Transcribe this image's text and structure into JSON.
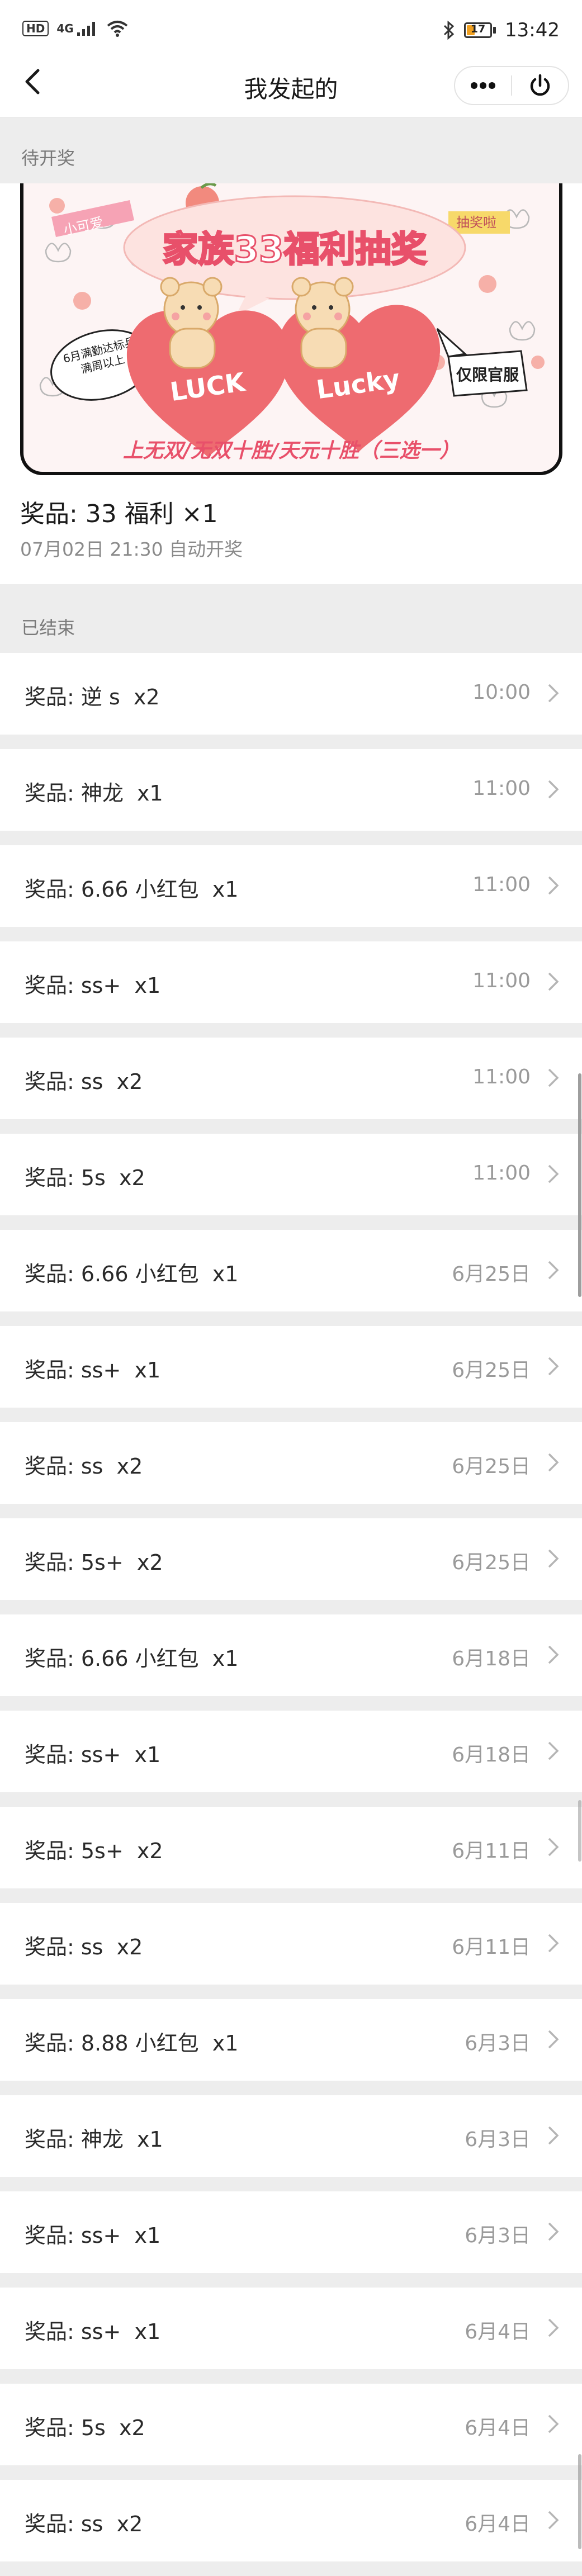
{
  "status_bar": {
    "left_badge": "HD",
    "network": "4G",
    "battery": "17",
    "time": "13:42",
    "icons": [
      "sim-icon",
      "signal-icon",
      "wifi-icon",
      "bluetooth-icon",
      "battery-icon"
    ]
  },
  "nav": {
    "title": "我发起的",
    "back_icon": "back-arrow-icon",
    "more_icon": "more-dots-icon",
    "close_icon": "power-icon"
  },
  "sections": {
    "pending": "待开奖",
    "ended": "已结束"
  },
  "pending": {
    "banner": {
      "headline": "家族33福利抽奖",
      "corner_tag_left": "小可爱",
      "corner_tag_right": "抽奖啦",
      "left_note": "6月满勤达标兵满周以上",
      "heart_left": "LUCK",
      "heart_right": "Lucky",
      "badge": "仅限官服",
      "bottom_text": "上无双/无双十胜/天元十胜（三选一）",
      "colors": {
        "pink": "#e8506a",
        "heart": "#ee6b70",
        "frame": "#111111",
        "bubble": "#fde3e0"
      }
    },
    "prize": "奖品: 33 福利 ×1",
    "draw_time": "07月02日 21:30 自动开奖"
  },
  "ended": [
    {
      "prize": "奖品: 逆 s  x2",
      "date": "10:00"
    },
    {
      "prize": "奖品: 神龙  x1",
      "date": "11:00"
    },
    {
      "prize": "奖品: 6.66 小红包  x1",
      "date": "11:00"
    },
    {
      "prize": "奖品: ss+  x1",
      "date": "11:00"
    },
    {
      "prize": "奖品: ss  x2",
      "date": "11:00"
    },
    {
      "prize": "奖品: 5s  x2",
      "date": "11:00"
    },
    {
      "prize": "奖品: 6.66 小红包  x1",
      "date": "6月25日"
    },
    {
      "prize": "奖品: ss+  x1",
      "date": "6月25日"
    },
    {
      "prize": "奖品: ss  x2",
      "date": "6月25日"
    },
    {
      "prize": "奖品: 5s+  x2",
      "date": "6月25日"
    },
    {
      "prize": "奖品: 6.66 小红包  x1",
      "date": "6月18日"
    },
    {
      "prize": "奖品: ss+  x1",
      "date": "6月18日"
    },
    {
      "prize": "奖品: 5s+  x2",
      "date": "6月11日"
    },
    {
      "prize": "奖品: ss  x2",
      "date": "6月11日"
    },
    {
      "prize": "奖品: 8.88 小红包  x1",
      "date": "6月3日"
    },
    {
      "prize": "奖品: 神龙  x1",
      "date": "6月3日"
    },
    {
      "prize": "奖品: ss+  x1",
      "date": "6月3日"
    },
    {
      "prize": "奖品: ss+  x1",
      "date": "6月4日"
    },
    {
      "prize": "奖品: 5s  x2",
      "date": "6月4日"
    },
    {
      "prize": "奖品: ss  x2",
      "date": "6月4日"
    }
  ]
}
